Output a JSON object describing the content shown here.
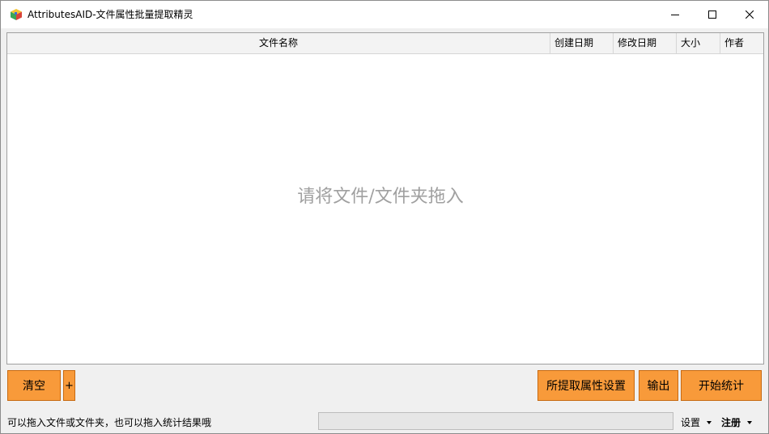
{
  "window": {
    "title": "AttributesAID-文件属性批量提取精灵",
    "icon": "cube-app-icon"
  },
  "list": {
    "columns": [
      "文件名称",
      "创建日期",
      "修改日期",
      "大小",
      "作者"
    ],
    "rows": [],
    "empty_hint": "请将文件/文件夹拖入"
  },
  "buttons": {
    "clear": "清空",
    "plus": "+",
    "attribute_settings": "所提取属性设置",
    "export": "输出",
    "start": "开始统计"
  },
  "statusbar": {
    "hint": "可以拖入文件或文件夹，也可以拖入统计结果哦",
    "progress": 0,
    "settings_menu": "设置",
    "register_menu": "注册"
  },
  "colors": {
    "button_bg": "#f89a3a",
    "button_border": "#c76a12",
    "hint_text": "#a0a0a0"
  }
}
